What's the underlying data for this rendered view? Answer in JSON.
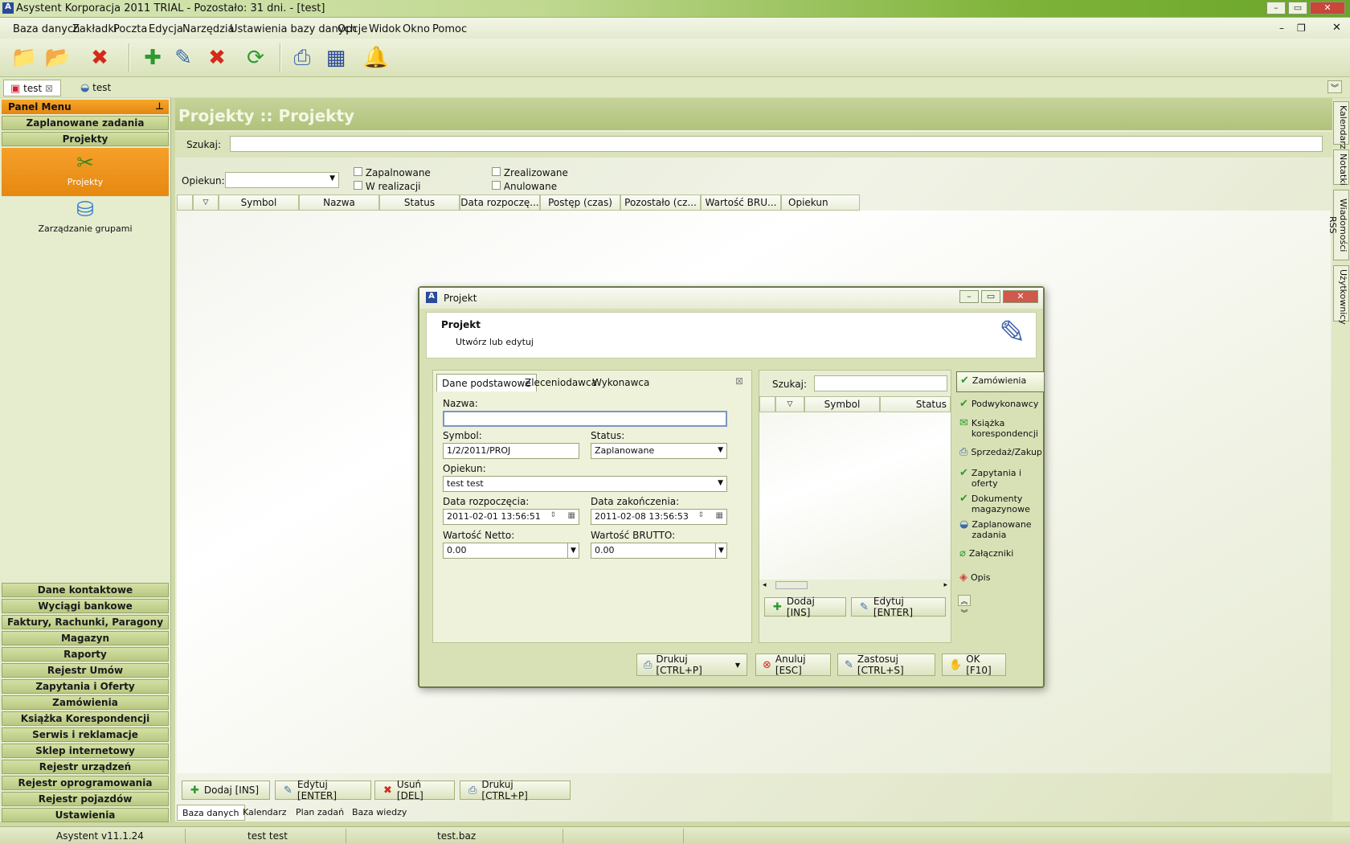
{
  "window": {
    "title": "Asystent Korporacja 2011 TRIAL - Pozostało: 31 dni. - [test]"
  },
  "menu": [
    "Baza danych",
    "Zakładki",
    "Poczta",
    "Edycja",
    "Narzędzia",
    "Ustawienia bazy danych",
    "Opcje",
    "Widok",
    "Okno",
    "Pomoc"
  ],
  "doc_tabs": [
    "test",
    "test"
  ],
  "panel": {
    "header": "Panel Menu",
    "top_buttons": [
      "Zaplanowane zadania",
      "Projekty"
    ],
    "big_items": [
      "Projekty",
      "Zarządzanie grupami"
    ],
    "bottom_buttons": [
      "Dane kontaktowe",
      "Wyciągi bankowe",
      "Faktury, Rachunki, Paragony",
      "Magazyn",
      "Raporty",
      "Rejestr Umów",
      "Zapytania i Oferty",
      "Zamówienia",
      "Książka Korespondencji",
      "Serwis i reklamacje",
      "Sklep internetowy",
      "Rejestr urządzeń",
      "Rejestr oprogramowania",
      "Rejestr pojazdów",
      "Ustawienia"
    ]
  },
  "main": {
    "title": "Projekty :: Projekty",
    "search_label": "Szukaj:",
    "owner_label": "Opiekun:",
    "filters": [
      "Zapalnowane",
      "W realizacji",
      "Zrealizowane",
      "Anulowane"
    ],
    "columns": [
      "Symbol",
      "Nazwa",
      "Status",
      "Data rozpoczę...",
      "Postęp (czas)",
      "Pozostało (cz...",
      "Wartość BRU...",
      "Opiekun"
    ],
    "buttons": [
      "Dodaj [INS]",
      "Edytuj [ENTER]",
      "Usuń [DEL]",
      "Drukuj [CTRL+P]"
    ],
    "bottom_tabs": [
      "Baza danych",
      "Kalendarz",
      "Plan zadań",
      "Baza wiedzy"
    ]
  },
  "right_tabs": [
    "Kalendarz",
    "Notatki",
    "Wiadomości RSS",
    "Użytkownicy"
  ],
  "status": {
    "version": "Asystent v11.1.24",
    "user": "test test",
    "file": "test.baz"
  },
  "dialog": {
    "title": "Projekt",
    "head_title": "Projekt",
    "head_subtitle": "Utwórz lub edytuj",
    "tabs": [
      "Dane podstawowe",
      "Zleceniodawca",
      "Wykonawca"
    ],
    "name_label": "Nazwa:",
    "name_value": "",
    "symbol_label": "Symbol:",
    "symbol_value": "1/2/2011/PROJ",
    "status_label": "Status:",
    "status_value": "Zaplanowane",
    "owner_label": "Opiekun:",
    "owner_value": "test test",
    "start_label": "Data rozpoczęcia:",
    "start_value": "2011-02-01   13:56:51",
    "end_label": "Data zakończenia:",
    "end_value": "2011-02-08   13:56:53",
    "net_label": "Wartość Netto:",
    "net_value": "0.00",
    "gross_label": "Wartość BRUTTO:",
    "gross_value": "0.00",
    "right_search_label": "Szukaj:",
    "right_columns": [
      "Symbol",
      "Status"
    ],
    "right_buttons": [
      "Dodaj [INS]",
      "Edytuj [ENTER]"
    ],
    "side_links": [
      "Zamówienia",
      "Podwykonawcy",
      "Książka korespondencji",
      "Sprzedaż/Zakup",
      "Zapytania i oferty",
      "Dokumenty magazynowe",
      "Zaplanowane zadania",
      "Załączniki",
      "Opis"
    ],
    "footer_buttons": [
      "Drukuj [CTRL+P]",
      "Anuluj [ESC]",
      "Zastosuj [CTRL+S]",
      "OK [F10]"
    ]
  }
}
